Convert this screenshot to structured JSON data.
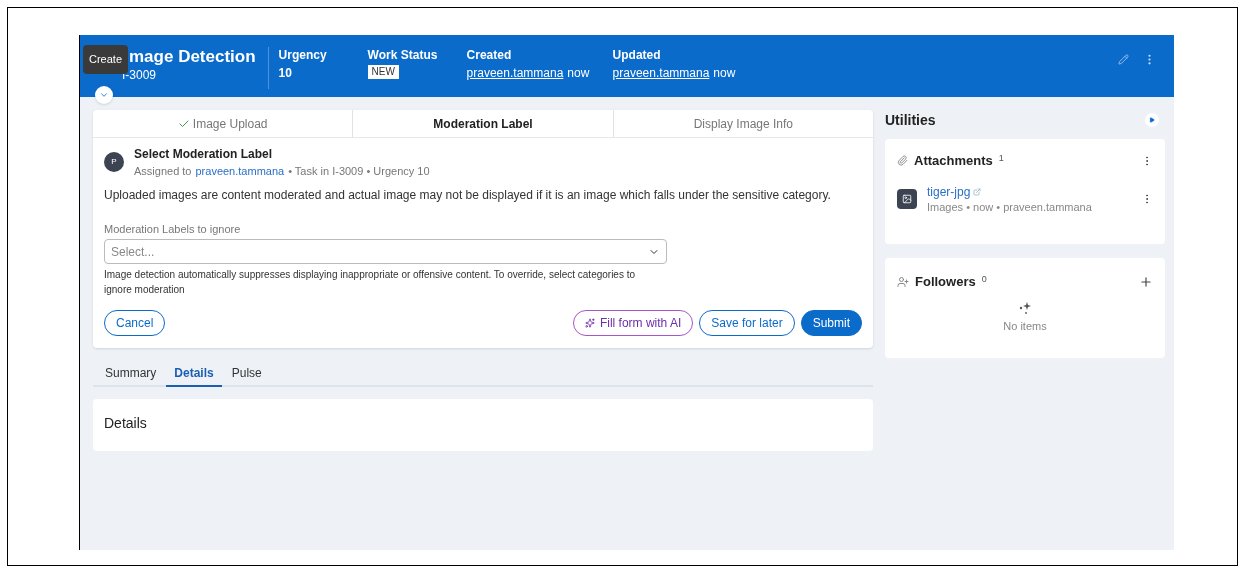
{
  "tooltip": {
    "text": "Create"
  },
  "header": {
    "title": "mage Detection",
    "id": "I-3009",
    "fields": [
      {
        "label": "Urgency",
        "kind": "text",
        "value": "10"
      },
      {
        "label": "Work Status",
        "kind": "badge",
        "value": "NEW"
      },
      {
        "label": "Created",
        "kind": "user",
        "user": "praveen.tammana",
        "time": "now"
      },
      {
        "label": "Updated",
        "kind": "user",
        "user": "praveen.tammana",
        "time": "now"
      }
    ]
  },
  "steps": [
    {
      "label": "Image Upload",
      "done": true,
      "selected": false
    },
    {
      "label": "Moderation Label",
      "done": false,
      "selected": true
    },
    {
      "label": "Display Image Info",
      "done": false,
      "selected": false
    }
  ],
  "task": {
    "avatar": "P",
    "title": "Select Moderation Label",
    "assigned_prefix": "Assigned to",
    "assignee": "praveen.tammana",
    "meta": "• Task in I-3009 • Urgency 10",
    "description": "Uploaded images are content moderated and actual image may not be displayed if it is an image which falls under the sensitive category.",
    "field_label": "Moderation Labels to ignore",
    "placeholder": "Select...",
    "help": "Image detection automatically suppresses displaying inappropriate or offensive content. To override, select categories to ignore moderation"
  },
  "buttons": [
    {
      "label": "Cancel",
      "kind": "outline"
    },
    {
      "label": "Fill form with AI",
      "kind": "ai"
    },
    {
      "label": "Save for later",
      "kind": "outline"
    },
    {
      "label": "Submit",
      "kind": "primary"
    }
  ],
  "tabs": [
    {
      "label": "Summary",
      "selected": false
    },
    {
      "label": "Details",
      "selected": true
    },
    {
      "label": "Pulse",
      "selected": false
    }
  ],
  "details": {
    "title": "Details"
  },
  "utilities": {
    "title": "Utilities",
    "attachments": {
      "title": "Attachments",
      "count": "1",
      "items": [
        {
          "name": "tiger-jpg",
          "meta": "Images • now • praveen.tammana"
        }
      ]
    },
    "followers": {
      "title": "Followers",
      "count": "0",
      "empty": "No items"
    }
  }
}
